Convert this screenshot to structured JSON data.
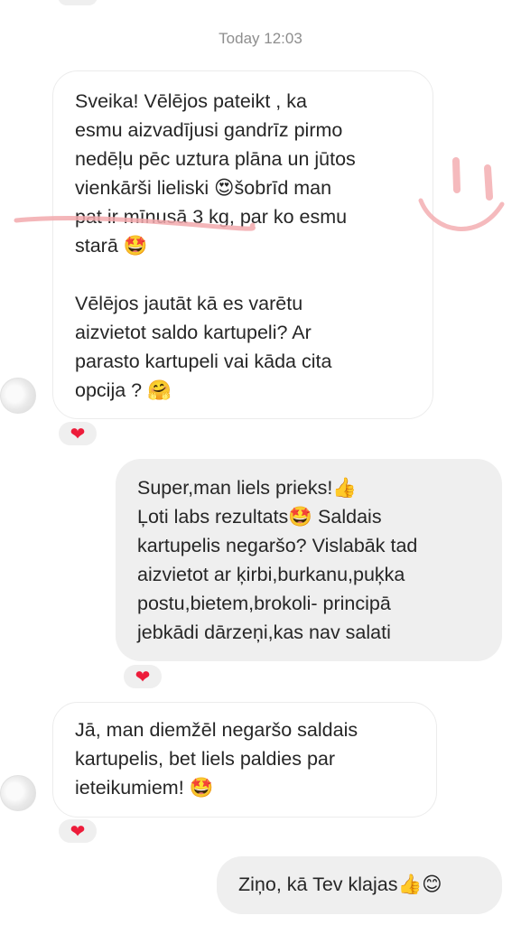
{
  "timestamp": "Today 12:03",
  "messages": [
    {
      "paragraphs": [
        "Sveika! Vēlējos pateikt , ka\nesmu aizvadījusi gandrīz pirmo\nnedēļu pēc uztura plāna un jūtos\nvienkārši lieliski 😍šobrīd man\npat ir mīnusā 3 kg, par ko esmu\nstarā 🤩",
        "Vēlējos jautāt kā es varētu\naizvietot saldo kartupeli? Ar\nparasto kartupeli vai kāda cita\nopcija ? 🤗"
      ]
    },
    {
      "paragraphs": [
        "Super,man liels prieks!👍\nĻoti labs rezultats🤩 Saldais\nkartupelis negaršo? Vislabāk tad\naizvietot ar ķirbi,burkanu,puķka\npostu,bietem,brokoli- principā\njebkādi dārzeņi,kas nav salati"
      ]
    },
    {
      "paragraphs": [
        "Jā, man diemžēl negaršo saldais\nkartupelis, bet liels paldies par\nieteikumiem! 🤩"
      ]
    },
    {
      "paragraphs": [
        "Ziņo, kā Tev klajas👍😊"
      ]
    }
  ],
  "reaction_emoji": "❤",
  "reaction_icon": "heart-icon",
  "colors": {
    "incoming_bg": "#ffffff",
    "outgoing_bg": "#efefef",
    "reaction": "#ed1c3a",
    "annotation": "#f2a9ad",
    "timestamp": "#8e8e8e"
  }
}
